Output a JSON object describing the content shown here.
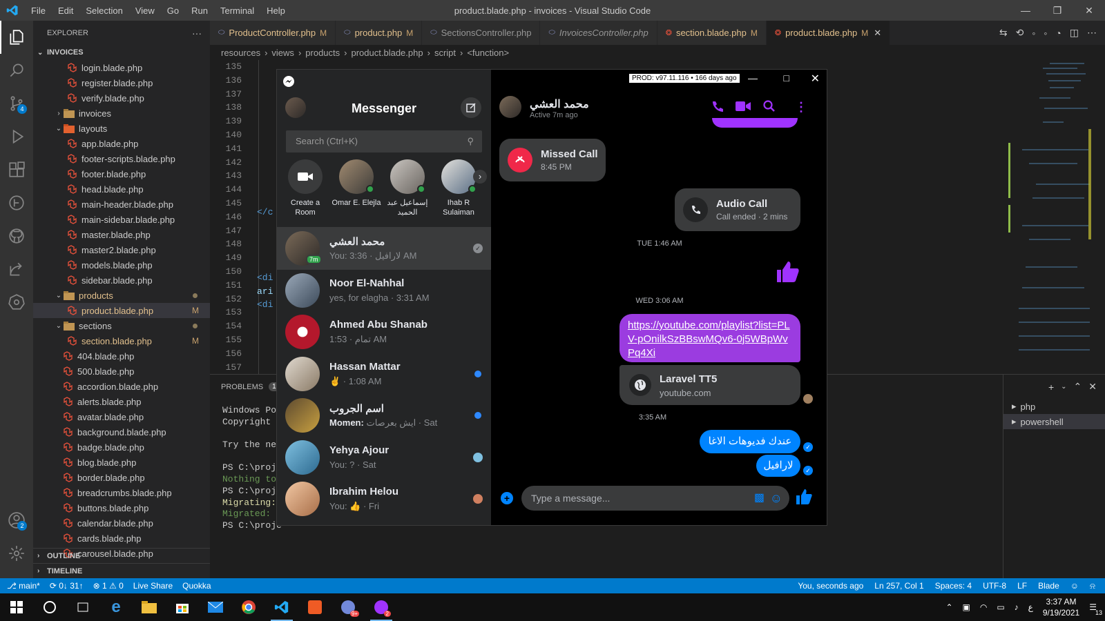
{
  "titlebar": {
    "menu": [
      "File",
      "Edit",
      "Selection",
      "View",
      "Go",
      "Run",
      "Terminal",
      "Help"
    ],
    "title": "product.blade.php - invoices - Visual Studio Code"
  },
  "activity": {
    "scm_badge": "4",
    "accounts_badge": "2"
  },
  "explorer": {
    "header": "EXPLORER",
    "more": "···",
    "section": "INVOICES",
    "items": [
      {
        "label": "login.blade.php",
        "depth": 3,
        "type": "blade"
      },
      {
        "label": "register.blade.php",
        "depth": 3,
        "type": "blade"
      },
      {
        "label": "verify.blade.php",
        "depth": 3,
        "type": "blade"
      },
      {
        "label": "invoices",
        "depth": 2,
        "type": "folder",
        "chev": "›"
      },
      {
        "label": "layouts",
        "depth": 2,
        "type": "folder-layout",
        "chev": "⌄"
      },
      {
        "label": "app.blade.php",
        "depth": 3,
        "type": "blade"
      },
      {
        "label": "footer-scripts.blade.php",
        "depth": 3,
        "type": "blade"
      },
      {
        "label": "footer.blade.php",
        "depth": 3,
        "type": "blade"
      },
      {
        "label": "head.blade.php",
        "depth": 3,
        "type": "blade"
      },
      {
        "label": "main-header.blade.php",
        "depth": 3,
        "type": "blade"
      },
      {
        "label": "main-sidebar.blade.php",
        "depth": 3,
        "type": "blade"
      },
      {
        "label": "master.blade.php",
        "depth": 3,
        "type": "blade"
      },
      {
        "label": "master2.blade.php",
        "depth": 3,
        "type": "blade"
      },
      {
        "label": "models.blade.php",
        "depth": 3,
        "type": "blade"
      },
      {
        "label": "sidebar.blade.php",
        "depth": 3,
        "type": "blade"
      },
      {
        "label": "products",
        "depth": 2,
        "type": "folder",
        "chev": "⌄",
        "mod": true,
        "dot": true
      },
      {
        "label": "product.blade.php",
        "depth": 3,
        "type": "blade",
        "mod": true,
        "mark": "M",
        "sel": true
      },
      {
        "label": "sections",
        "depth": 2,
        "type": "folder",
        "chev": "⌄",
        "dot": true
      },
      {
        "label": "section.blade.php",
        "depth": 3,
        "type": "blade",
        "mod": true,
        "mark": "M"
      },
      {
        "label": "404.blade.php",
        "depth": 2,
        "type": "blade"
      },
      {
        "label": "500.blade.php",
        "depth": 2,
        "type": "blade"
      },
      {
        "label": "accordion.blade.php",
        "depth": 2,
        "type": "blade"
      },
      {
        "label": "alerts.blade.php",
        "depth": 2,
        "type": "blade"
      },
      {
        "label": "avatar.blade.php",
        "depth": 2,
        "type": "blade"
      },
      {
        "label": "background.blade.php",
        "depth": 2,
        "type": "blade"
      },
      {
        "label": "badge.blade.php",
        "depth": 2,
        "type": "blade"
      },
      {
        "label": "blog.blade.php",
        "depth": 2,
        "type": "blade"
      },
      {
        "label": "border.blade.php",
        "depth": 2,
        "type": "blade"
      },
      {
        "label": "breadcrumbs.blade.php",
        "depth": 2,
        "type": "blade"
      },
      {
        "label": "buttons.blade.php",
        "depth": 2,
        "type": "blade"
      },
      {
        "label": "calendar.blade.php",
        "depth": 2,
        "type": "blade"
      },
      {
        "label": "cards.blade.php",
        "depth": 2,
        "type": "blade"
      },
      {
        "label": "carousel.blade.php",
        "depth": 2,
        "type": "blade"
      }
    ],
    "outline": "OUTLINE",
    "timeline": "TIMELINE"
  },
  "tabs": [
    {
      "label": "ProductController.php",
      "mark": "M",
      "italic": false
    },
    {
      "label": "product.php",
      "mark": "M",
      "italic": false
    },
    {
      "label": "SectionsController.php",
      "mark": "",
      "italic": false
    },
    {
      "label": "InvoicesController.php",
      "mark": "",
      "italic": true
    },
    {
      "label": "section.blade.php",
      "mark": "M",
      "italic": false
    },
    {
      "label": "product.blade.php",
      "mark": "M",
      "italic": false,
      "active": true
    }
  ],
  "breadcrumb": [
    "resources",
    "views",
    "products",
    "product.blade.php",
    "script",
    "<function>"
  ],
  "line_numbers": [
    "135",
    "136",
    "137",
    "138",
    "139",
    "140",
    "141",
    "142",
    "143",
    "144",
    "145",
    "146",
    "147",
    "148",
    "149",
    "150",
    "151",
    "152",
    "153",
    "154",
    "155",
    "156",
    "157"
  ],
  "code_fragments": {
    "l145": "</c",
    "l150": "<di",
    "l151": "ari",
    "l152": "<di"
  },
  "panel": {
    "tab": "PROBLEMS",
    "badge": "1",
    "terminal": [
      {
        "text": "Windows Pow",
        "color": "#cccccc"
      },
      {
        "text": "Copyright (",
        "color": "#cccccc"
      },
      {
        "text": "",
        "color": "#cccccc"
      },
      {
        "text": "Try the new",
        "color": "#cccccc"
      },
      {
        "text": "",
        "color": "#cccccc"
      },
      {
        "text": "PS C:\\proje",
        "color": "#cccccc"
      },
      {
        "text": "Nothing to ",
        "color": "#6a9955"
      },
      {
        "text": "PS C:\\proje",
        "color": "#cccccc"
      },
      {
        "text": "Migrating:",
        "color": "#dcdcaa"
      },
      {
        "text": "Migrated: ",
        "color": "#6a9955"
      },
      {
        "text": "PS C:\\proje",
        "color": "#cccccc"
      }
    ],
    "terminals": [
      {
        "label": "php"
      },
      {
        "label": "powershell",
        "sel": true
      }
    ]
  },
  "statusbar": {
    "branch": "main*",
    "sync": "0↓ 31↑",
    "problems": "⊗ 1 ⚠ 0",
    "liveshare": "Live Share",
    "quokka": "Quokka",
    "blame": "You, seconds ago",
    "position": "Ln 257, Col 1",
    "spaces": "Spaces: 4",
    "encoding": "UTF-8",
    "eol": "LF",
    "lang": "Blade"
  },
  "taskbar": {
    "time": "3:37 AM",
    "date": "9/19/2021",
    "lang": "ع",
    "notif": "13",
    "discord_badge": "9+",
    "messenger_badge": "2"
  },
  "messenger": {
    "build": "PROD: v97.11.116 • 166 days ago",
    "title": "Messenger",
    "search_placeholder": "Search (Ctrl+K)",
    "stories": [
      {
        "label": "Create a Room"
      },
      {
        "label": "Omar E. Elejla",
        "online": true
      },
      {
        "label": "إسماعيل عبد الحميد",
        "online": true
      },
      {
        "label": "Ihab R Sulaiman",
        "online": true
      }
    ],
    "conversations": [
      {
        "name": "محمد العشي",
        "preview": "You: لارافيل · 3:36 AM",
        "selected": true,
        "badge": "7m",
        "status": "read"
      },
      {
        "name": "Noor El-Nahhal",
        "preview": "yes, for elagha · 3:31 AM"
      },
      {
        "name": "Ahmed Abu Shanab",
        "preview": "تمام · 1:53 AM"
      },
      {
        "name": "Hassan Mattar",
        "preview": "✌ · 1:08 AM",
        "unread": true
      },
      {
        "name": "اسم الجروب",
        "preview_bold": "Momen:",
        "preview": "ايش بعرصات · Sat",
        "unread": true
      },
      {
        "name": "Yehya Ajour",
        "preview": "You: ? · Sat"
      },
      {
        "name": "Ibrahim Helou",
        "preview": "You: 👍 · Fri"
      }
    ],
    "chat": {
      "name": "محمد العشي",
      "status": "Active 7m ago",
      "missed_call": {
        "title": "Missed Call",
        "time": "8:45 PM"
      },
      "audio_call": {
        "title": "Audio Call",
        "sub": "Call ended · 2 mins"
      },
      "ts1": "TUE 1:46 AM",
      "ts2": "WED 3:06 AM",
      "link": "https://youtube.com/playlist?list=PLV-pOnilkSzBBswMQv6-0j5WBpWvPq4Xi",
      "preview_title": "Laravel TT5",
      "preview_domain": "youtube.com",
      "ts3": "3:35 AM",
      "msg1": "عندك فديوهات الاغا",
      "msg2": "لارافيل",
      "composer_placeholder": "Type a message..."
    },
    "colors": {
      "accent": "#0084ff",
      "purple": "#a033ff",
      "missed": "#f02849"
    }
  }
}
